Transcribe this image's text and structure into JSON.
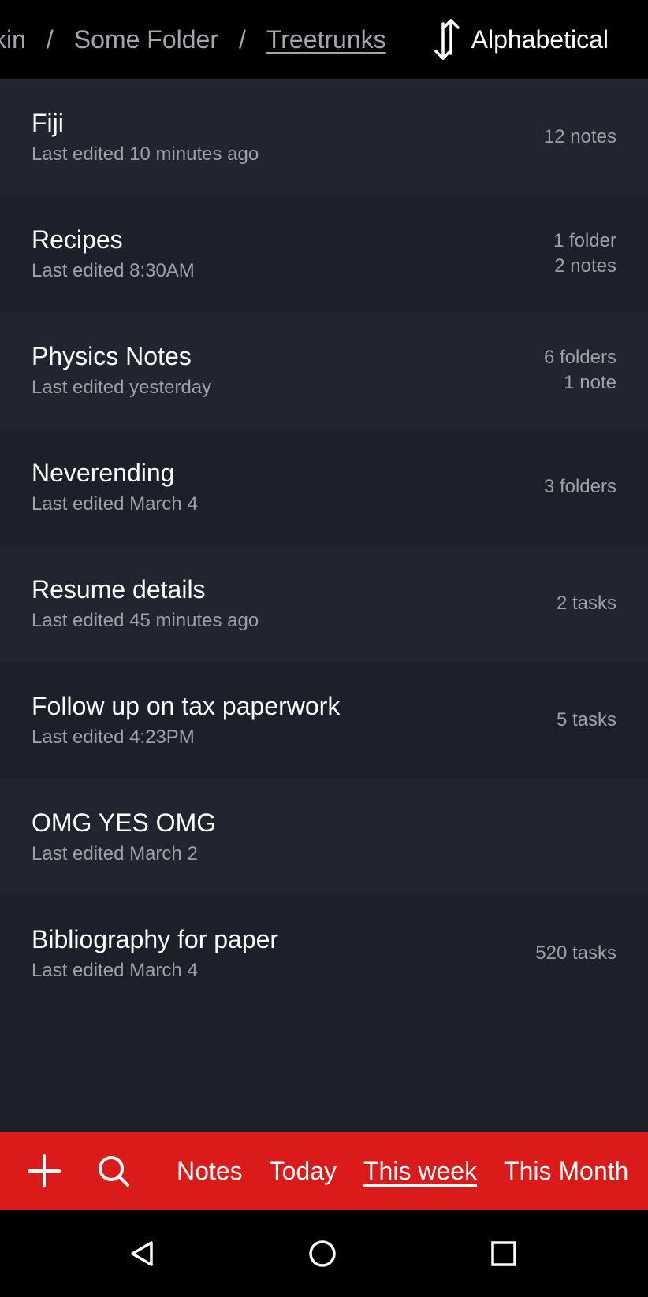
{
  "breadcrumb": {
    "items": [
      "kin",
      "Some Folder",
      "Treetrunks"
    ],
    "separator": "/"
  },
  "sort": {
    "icon": "sort-arrows-icon",
    "label": "Alphabetical"
  },
  "items": [
    {
      "title": "Fiji",
      "subtitle": "Last edited 10 minutes ago",
      "meta1": "12 notes",
      "meta2": ""
    },
    {
      "title": "Recipes",
      "subtitle": "Last edited 8:30AM",
      "meta1": "1 folder",
      "meta2": "2 notes"
    },
    {
      "title": "Physics Notes",
      "subtitle": "Last edited yesterday",
      "meta1": "6 folders",
      "meta2": "1 note"
    },
    {
      "title": "Neverending",
      "subtitle": "Last edited March 4",
      "meta1": "3 folders",
      "meta2": ""
    },
    {
      "title": "Resume details",
      "subtitle": "Last edited 45 minutes ago",
      "meta1": "2 tasks",
      "meta2": ""
    },
    {
      "title": "Follow up on tax paperwork",
      "subtitle": "Last edited 4:23PM",
      "meta1": "5 tasks",
      "meta2": ""
    },
    {
      "title": "OMG YES OMG",
      "subtitle": "Last edited March 2",
      "meta1": "",
      "meta2": ""
    },
    {
      "title": "Bibliography for paper",
      "subtitle": "Last edited March 4",
      "meta1": "520 tasks",
      "meta2": ""
    }
  ],
  "bottom_bar": {
    "add_icon": "plus-icon",
    "search_icon": "search-icon",
    "tabs": [
      "Notes",
      "Today",
      "This week",
      "This Month"
    ],
    "active_tab": "This week"
  },
  "system_nav": {
    "back_icon": "back-triangle-icon",
    "home_icon": "home-circle-icon",
    "recents_icon": "recents-square-icon"
  },
  "colors": {
    "background": "#1b202a",
    "row_alt": "#20252f",
    "accent": "#db1a1a",
    "text_primary": "#ffffff",
    "text_secondary": "#9ea1a8"
  }
}
